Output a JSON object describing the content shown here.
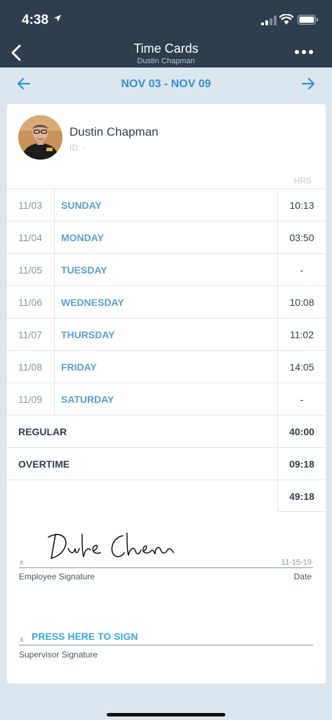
{
  "status_bar": {
    "time": "4:38"
  },
  "nav": {
    "title": "Time Cards",
    "subtitle": "Dustin Chapman"
  },
  "week": {
    "range": "NOV 03 - NOV 09"
  },
  "employee": {
    "name": "Dustin Chapman",
    "id_label": "ID:  -"
  },
  "table": {
    "hrs_header": "HRS",
    "days": [
      {
        "date": "11/03",
        "day": "SUNDAY",
        "hrs": "10:13"
      },
      {
        "date": "11/04",
        "day": "MONDAY",
        "hrs": "03:50"
      },
      {
        "date": "11/05",
        "day": "TUESDAY",
        "hrs": "-"
      },
      {
        "date": "11/06",
        "day": "WEDNESDAY",
        "hrs": "10:08"
      },
      {
        "date": "11/07",
        "day": "THURSDAY",
        "hrs": "11:02"
      },
      {
        "date": "11/08",
        "day": "FRIDAY",
        "hrs": "14:05"
      },
      {
        "date": "11/09",
        "day": "SATURDAY",
        "hrs": "-"
      }
    ],
    "regular_label": "REGULAR",
    "regular_hrs": "40:00",
    "overtime_label": "OVERTIME",
    "overtime_hrs": "09:18",
    "total_hrs": "49:18"
  },
  "signatures": {
    "x_mark": "x",
    "employee_signature_label": "Employee Signature",
    "employee_signed_date": "11-15-19",
    "date_label": "Date",
    "employee_signature_text": "Dustin Chapman",
    "press_to_sign": "PRESS HERE TO SIGN",
    "supervisor_signature_label": "Supervisor Signature"
  },
  "colors": {
    "header_bg": "#2e3e4f",
    "page_bg": "#dbe6ee",
    "accent_blue": "#3a8fd6",
    "day_blue": "#5b9fd0",
    "sign_blue": "#3aa9d8"
  },
  "icons": {
    "back": "chevron-left-icon",
    "more": "more-dots-icon",
    "prev_week": "arrow-left-icon",
    "next_week": "arrow-right-icon",
    "location": "location-arrow-icon",
    "signal": "cell-signal-icon",
    "wifi": "wifi-icon",
    "battery": "battery-icon"
  }
}
